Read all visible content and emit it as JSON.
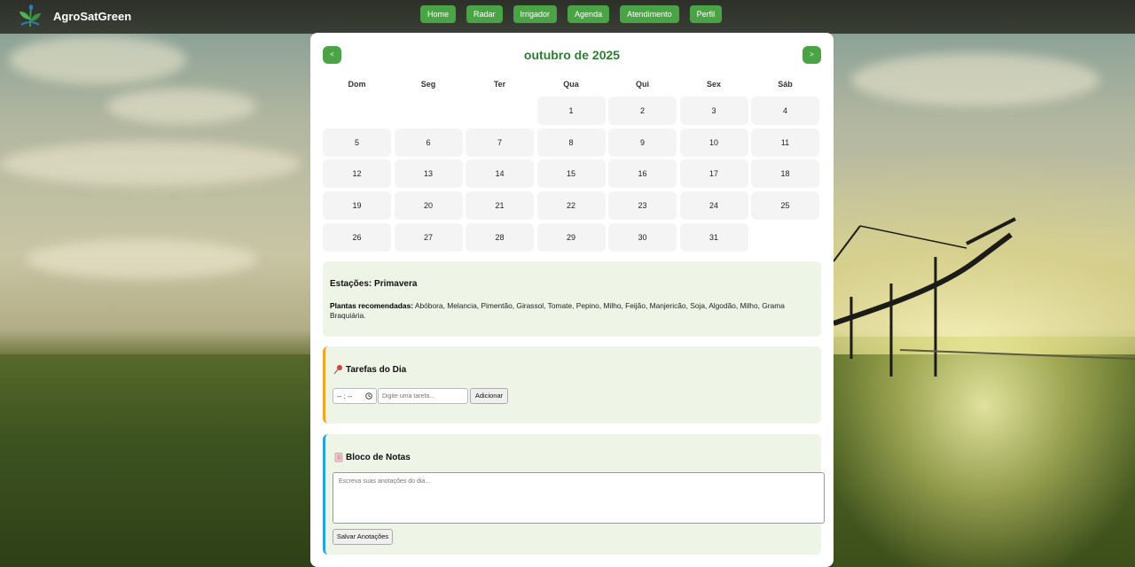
{
  "app": {
    "title": "AgroSatGreen"
  },
  "nav": [
    {
      "label": "Home"
    },
    {
      "label": "Radar"
    },
    {
      "label": "Irrigador"
    },
    {
      "label": "Agenda"
    },
    {
      "label": "Atendimento"
    },
    {
      "label": "Perfil"
    }
  ],
  "calendar": {
    "month_title": "outubro de 2025",
    "prev_label": "<",
    "next_label": ">",
    "weekdays": [
      "Dom",
      "Seg",
      "Ter",
      "Qua",
      "Qui",
      "Sex",
      "Sáb"
    ],
    "first_weekday_index": 3,
    "days": [
      "1",
      "2",
      "3",
      "4",
      "5",
      "6",
      "7",
      "8",
      "9",
      "10",
      "11",
      "12",
      "13",
      "14",
      "15",
      "16",
      "17",
      "18",
      "19",
      "20",
      "21",
      "22",
      "23",
      "24",
      "25",
      "26",
      "27",
      "28",
      "29",
      "30",
      "31"
    ]
  },
  "season": {
    "title": "Estações: Primavera",
    "plants_label": "Plantas recomendadas:",
    "plants_text": "Abóbora, Melancia, Pimentão, Girassol, Tomate, Pepino, Milho, Feijão, Manjericão, Soja, Algodão, Milho, Grama Braquiária."
  },
  "tasks": {
    "icon": "pushpin-icon",
    "title": "Tarefas do Dia",
    "time_placeholder": "-- : --",
    "input_placeholder": "Digite uma tarefa...",
    "add_label": "Adicionar",
    "accent_color": "#f3a625"
  },
  "notes": {
    "icon": "notebook-icon",
    "title": "Bloco de Notas",
    "textarea_placeholder": "Escreva suas anotações do dia...",
    "save_label": "Salvar Anotações",
    "accent_color": "#29a3dd"
  },
  "colors": {
    "brand_green": "#4aa446",
    "title_green": "#2e7d32",
    "card_bg": "#eef4e6"
  }
}
